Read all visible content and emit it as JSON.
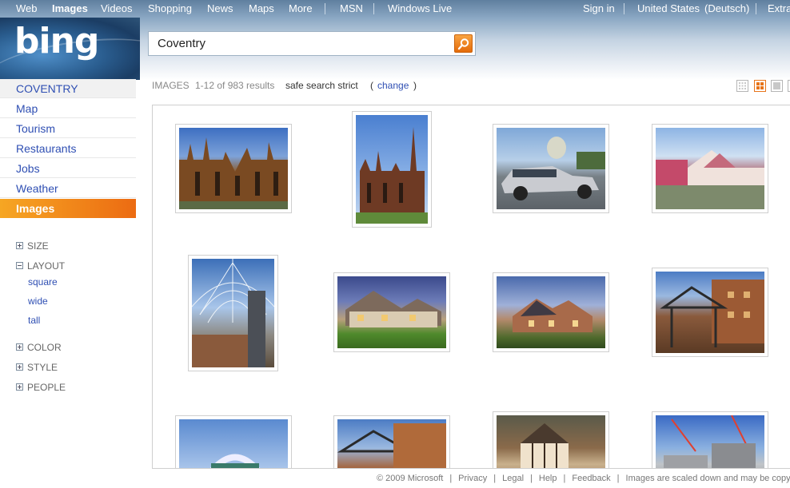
{
  "topnav": {
    "left": [
      "Web",
      "Images",
      "Videos",
      "Shopping",
      "News",
      "Maps",
      "More",
      "MSN",
      "Windows Live"
    ],
    "right": [
      "Sign in",
      "United States",
      "(Deutsch)",
      "Extra"
    ]
  },
  "logo": "bing",
  "search": {
    "value": "Coventry"
  },
  "sidebar": {
    "items": [
      "COVENTRY",
      "Map",
      "Tourism",
      "Restaurants",
      "Jobs",
      "Weather",
      "Images"
    ],
    "filters": {
      "size": "SIZE",
      "layout": "LAYOUT",
      "layout_options": [
        "square",
        "wide",
        "tall"
      ],
      "color": "COLOR",
      "style": "STYLE",
      "people": "PEOPLE"
    }
  },
  "results": {
    "label": "IMAGES",
    "count": "1-12 of 983 results",
    "safe": "safe search strict",
    "paren_open": "(",
    "change": "change",
    "paren_close": ")"
  },
  "thumbs": [
    {
      "name": "cathedral-ruins"
    },
    {
      "name": "cathedral-spire"
    },
    {
      "name": "jaguar-car"
    },
    {
      "name": "victorian-house"
    },
    {
      "name": "glass-dome"
    },
    {
      "name": "suburban-house"
    },
    {
      "name": "brick-house"
    },
    {
      "name": "hotel-entrance"
    },
    {
      "name": "arena-arch"
    },
    {
      "name": "hotel-canopy"
    },
    {
      "name": "tudor-building"
    },
    {
      "name": "construction-site"
    }
  ],
  "footer": [
    "© 2009 Microsoft",
    "|",
    "Privacy",
    "|",
    "Legal",
    "|",
    "Help",
    "|",
    "Feedback",
    "|",
    "Images are scaled down and may be copyright"
  ],
  "colors": {
    "accent": "#ec6b12",
    "link": "#2f4fb3"
  }
}
